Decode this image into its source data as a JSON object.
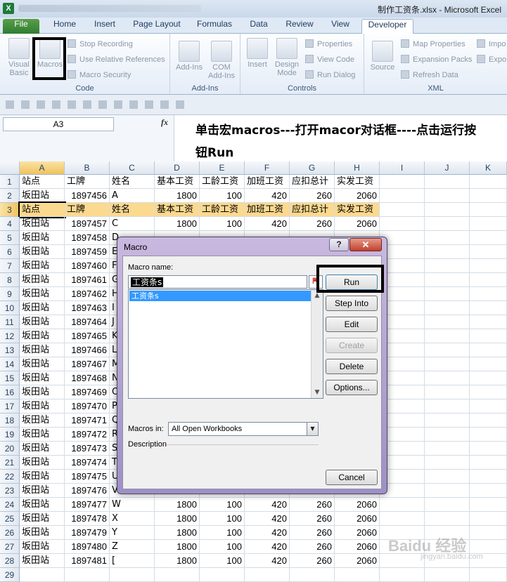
{
  "window": {
    "title": "制作工资条.xlsx - Microsoft Excel",
    "app_icon": "X"
  },
  "tabs": [
    "File",
    "Home",
    "Insert",
    "Page Layout",
    "Formulas",
    "Data",
    "Review",
    "View",
    "Developer"
  ],
  "ribbon": {
    "code": {
      "visual_basic": "Visual Basic",
      "macros": "Macros",
      "stop_recording": "Stop Recording",
      "relative_refs": "Use Relative References",
      "macro_security": "Macro Security",
      "label": "Code"
    },
    "addins": {
      "addins": "Add-Ins",
      "com_addins": "COM Add-Ins",
      "label": "Add-Ins"
    },
    "controls": {
      "insert": "Insert",
      "design_mode": "Design Mode",
      "properties": "Properties",
      "view_code": "View Code",
      "run_dialog": "Run Dialog",
      "label": "Controls"
    },
    "xml": {
      "source": "Source",
      "map_properties": "Map Properties",
      "expansion_packs": "Expansion Packs",
      "refresh_data": "Refresh Data",
      "import": "Impo",
      "export": "Expo",
      "label": "XML"
    }
  },
  "formula_bar": {
    "name_box": "A3",
    "fx": "fx",
    "content": "单击宏macros---打开macor对话框----点击运行按钮Run"
  },
  "columns": [
    "A",
    "B",
    "C",
    "D",
    "E",
    "F",
    "G",
    "H",
    "I",
    "J",
    "K"
  ],
  "header_row": [
    "站点",
    "工牌",
    "姓名",
    "基本工资",
    "工龄工资",
    "加班工资",
    "应扣总计",
    "实发工资"
  ],
  "rows": [
    {
      "n": "1",
      "cells": [
        "站点",
        "工牌",
        "姓名",
        "基本工资",
        "工龄工资",
        "加班工资",
        "应扣总计",
        "实发工资"
      ]
    },
    {
      "n": "2",
      "cells": [
        "坂田站",
        "1897456",
        "A",
        "1800",
        "100",
        "420",
        "260",
        "2060"
      ]
    },
    {
      "n": "3",
      "cells": [
        "站点",
        "工牌",
        "姓名",
        "基本工资",
        "工龄工资",
        "加班工资",
        "应扣总计",
        "实发工资"
      ]
    },
    {
      "n": "4",
      "cells": [
        "坂田站",
        "1897457",
        "C",
        "1800",
        "100",
        "420",
        "260",
        "2060"
      ]
    },
    {
      "n": "5",
      "cells": [
        "坂田站",
        "1897458",
        "D",
        "",
        "",
        "",
        "",
        ""
      ]
    },
    {
      "n": "6",
      "cells": [
        "坂田站",
        "1897459",
        "E",
        "",
        "",
        "",
        "",
        ""
      ]
    },
    {
      "n": "7",
      "cells": [
        "坂田站",
        "1897460",
        "F",
        "",
        "",
        "",
        "",
        ""
      ]
    },
    {
      "n": "8",
      "cells": [
        "坂田站",
        "1897461",
        "G",
        "",
        "",
        "",
        "",
        ""
      ]
    },
    {
      "n": "9",
      "cells": [
        "坂田站",
        "1897462",
        "H",
        "",
        "",
        "",
        "",
        ""
      ]
    },
    {
      "n": "10",
      "cells": [
        "坂田站",
        "1897463",
        "I",
        "",
        "",
        "",
        "",
        ""
      ]
    },
    {
      "n": "11",
      "cells": [
        "坂田站",
        "1897464",
        "J",
        "",
        "",
        "",
        "",
        ""
      ]
    },
    {
      "n": "12",
      "cells": [
        "坂田站",
        "1897465",
        "K",
        "",
        "",
        "",
        "",
        ""
      ]
    },
    {
      "n": "13",
      "cells": [
        "坂田站",
        "1897466",
        "L",
        "",
        "",
        "",
        "",
        ""
      ]
    },
    {
      "n": "14",
      "cells": [
        "坂田站",
        "1897467",
        "M",
        "",
        "",
        "",
        "",
        ""
      ]
    },
    {
      "n": "15",
      "cells": [
        "坂田站",
        "1897468",
        "N",
        "",
        "",
        "",
        "",
        ""
      ]
    },
    {
      "n": "16",
      "cells": [
        "坂田站",
        "1897469",
        "O",
        "",
        "",
        "",
        "",
        ""
      ]
    },
    {
      "n": "17",
      "cells": [
        "坂田站",
        "1897470",
        "P",
        "",
        "",
        "",
        "",
        ""
      ]
    },
    {
      "n": "18",
      "cells": [
        "坂田站",
        "1897471",
        "Q",
        "",
        "",
        "",
        "",
        ""
      ]
    },
    {
      "n": "19",
      "cells": [
        "坂田站",
        "1897472",
        "R",
        "",
        "",
        "",
        "",
        ""
      ]
    },
    {
      "n": "20",
      "cells": [
        "坂田站",
        "1897473",
        "S",
        "",
        "",
        "",
        "",
        ""
      ]
    },
    {
      "n": "21",
      "cells": [
        "坂田站",
        "1897474",
        "T",
        "",
        "",
        "",
        "",
        ""
      ]
    },
    {
      "n": "22",
      "cells": [
        "坂田站",
        "1897475",
        "U",
        "",
        "",
        "",
        "",
        ""
      ]
    },
    {
      "n": "23",
      "cells": [
        "坂田站",
        "1897476",
        "V",
        "",
        "",
        "",
        "",
        ""
      ]
    },
    {
      "n": "24",
      "cells": [
        "坂田站",
        "1897477",
        "W",
        "1800",
        "100",
        "420",
        "260",
        "2060"
      ]
    },
    {
      "n": "25",
      "cells": [
        "坂田站",
        "1897478",
        "X",
        "1800",
        "100",
        "420",
        "260",
        "2060"
      ]
    },
    {
      "n": "26",
      "cells": [
        "坂田站",
        "1897479",
        "Y",
        "1800",
        "100",
        "420",
        "260",
        "2060"
      ]
    },
    {
      "n": "27",
      "cells": [
        "坂田站",
        "1897480",
        "Z",
        "1800",
        "100",
        "420",
        "260",
        "2060"
      ]
    },
    {
      "n": "28",
      "cells": [
        "坂田站",
        "1897481",
        "[",
        "1800",
        "100",
        "420",
        "260",
        "2060"
      ]
    },
    {
      "n": "29",
      "cells": [
        "",
        "",
        "",
        "",
        "",
        "",
        "",
        ""
      ]
    }
  ],
  "dialog": {
    "title": "Macro",
    "help": "?",
    "close": "✕",
    "macro_name_label": "Macro name:",
    "macro_name_value": "工资条s",
    "ref_icon": "⇱",
    "list_items": [
      "工资条s"
    ],
    "buttons": {
      "run": "Run",
      "step_into": "Step Into",
      "edit": "Edit",
      "create": "Create",
      "delete": "Delete",
      "options": "Options...",
      "cancel": "Cancel"
    },
    "macros_in_label": "Macros in:",
    "macros_in_value": "All Open Workbooks",
    "description_label": "Description"
  },
  "watermark": {
    "main": "Baidu 经验",
    "sub": "jingyan.baidu.com"
  }
}
